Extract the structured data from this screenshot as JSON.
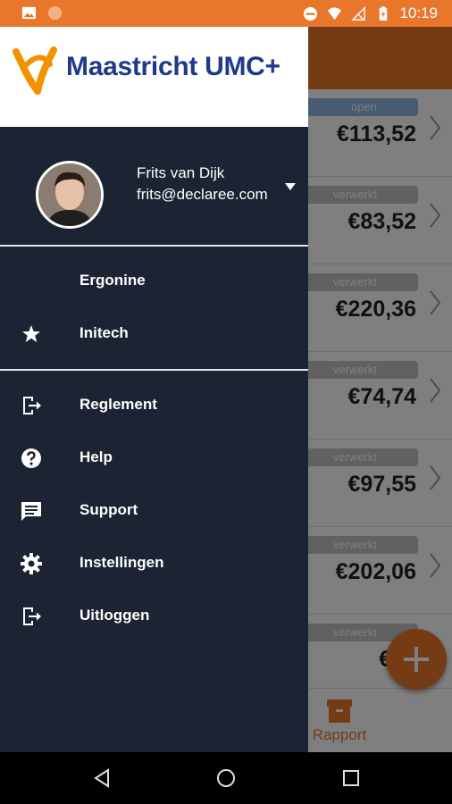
{
  "status_bar": {
    "time": "10:19"
  },
  "background_list": {
    "rows": [
      {
        "status": "open",
        "amount": "€113,52"
      },
      {
        "status": "verwerkt",
        "amount": "€83,52"
      },
      {
        "status": "verwerkt",
        "amount": "€220,36"
      },
      {
        "status": "verwerkt",
        "amount": "€74,74"
      },
      {
        "status": "verwerkt",
        "amount": "€97,55"
      },
      {
        "status": "verwerkt",
        "amount": "€202,06"
      },
      {
        "status": "verwerkt",
        "amount": "€74"
      }
    ],
    "bottom_nav": {
      "label": "Rapport"
    }
  },
  "drawer": {
    "logo_text": "Maastricht UMC+",
    "user": {
      "name": "Frits van Dijk",
      "email": "frits@declaree.com"
    },
    "accounts": [
      {
        "label": "Ergonine",
        "icon": "none"
      },
      {
        "label": "Initech",
        "icon": "star-icon"
      }
    ],
    "menu": [
      {
        "label": "Reglement",
        "icon": "exit-icon"
      },
      {
        "label": "Help",
        "icon": "help-icon"
      },
      {
        "label": "Support",
        "icon": "chat-icon"
      },
      {
        "label": "Instellingen",
        "icon": "gear-icon"
      },
      {
        "label": "Uitloggen",
        "icon": "logout-icon"
      }
    ]
  },
  "colors": {
    "accent": "#e8762b",
    "drawer_bg": "#1c2433",
    "logo_blue": "#1f3a8a"
  }
}
